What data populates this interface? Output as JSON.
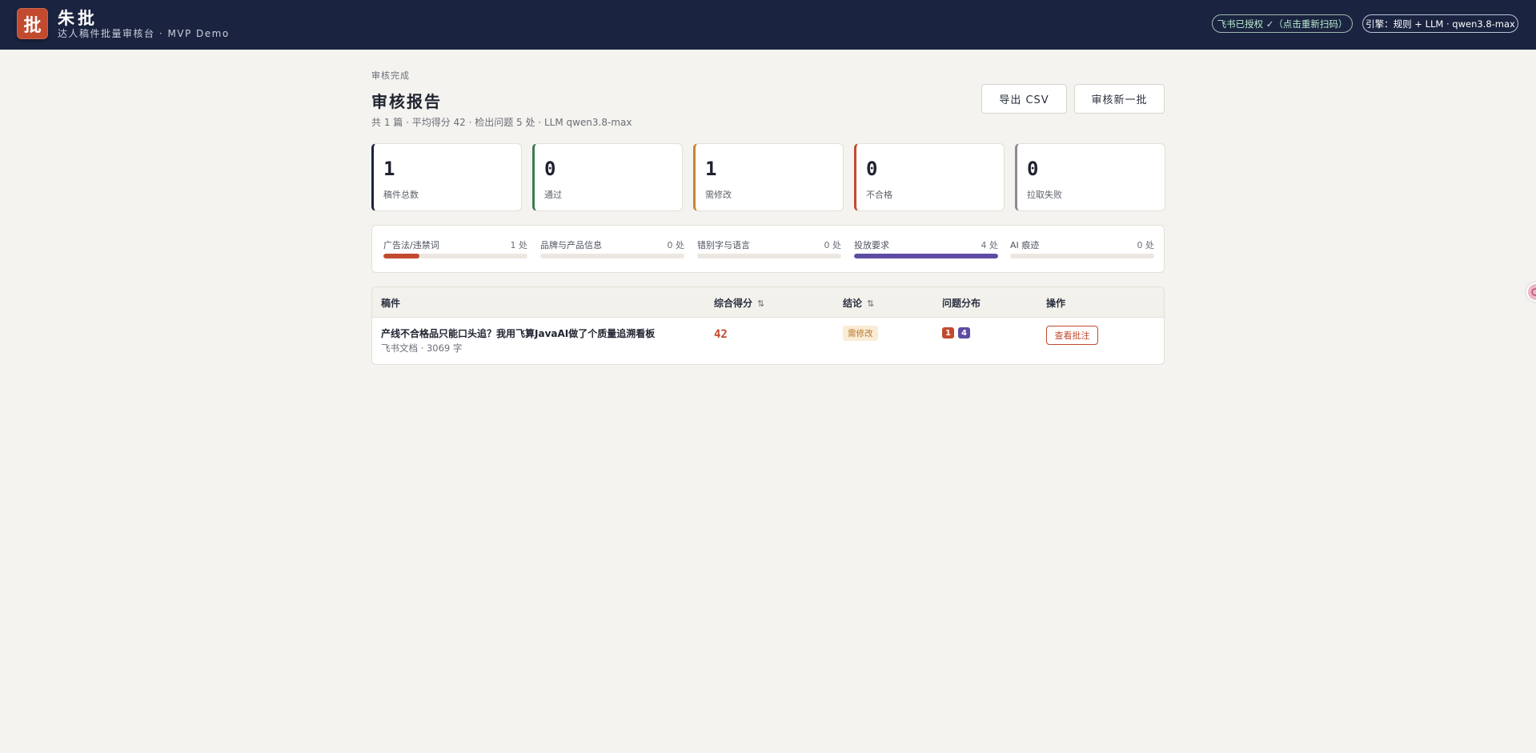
{
  "header": {
    "logo_char": "批",
    "brand_name": "朱批",
    "brand_subtitle": "达人稿件批量审核台 · MVP Demo",
    "auth_status": "飞书已授权 ✓（点击重新扫码）",
    "engine": "引擎：规则 + LLM · qwen3.8-max"
  },
  "report": {
    "eyebrow": "审核完成",
    "title": "审核报告",
    "summary": "共 1 篇 · 平均得分 42 · 检出问题 5 处 · LLM qwen3.8-max",
    "export_label": "导出 CSV",
    "new_batch_label": "审核新一批"
  },
  "stats": [
    {
      "value": "1",
      "label": "稿件总数",
      "color": "#1a2440"
    },
    {
      "value": "0",
      "label": "通过",
      "color": "#3e7a52"
    },
    {
      "value": "1",
      "label": "需修改",
      "color": "#c98430"
    },
    {
      "value": "0",
      "label": "不合格",
      "color": "#c24a2f"
    },
    {
      "value": "0",
      "label": "拉取失败",
      "color": "#8f8a96"
    }
  ],
  "categories": [
    {
      "name": "广告法/违禁词",
      "count": "1 处",
      "value": 1,
      "color": "#c24a2f"
    },
    {
      "name": "品牌与产品信息",
      "count": "0 处",
      "value": 0,
      "color": "#c24a2f"
    },
    {
      "name": "错别字与语言",
      "count": "0 处",
      "value": 0,
      "color": "#c24a2f"
    },
    {
      "name": "投放要求",
      "count": "4 处",
      "value": 4,
      "color": "#5e4ca3"
    },
    {
      "name": "AI 痕迹",
      "count": "0 处",
      "value": 0,
      "color": "#c24a2f"
    }
  ],
  "category_max": 4,
  "table": {
    "headers": {
      "doc": "稿件",
      "score": "综合得分",
      "verdict": "结论",
      "issues": "问题分布",
      "action": "操作"
    },
    "sort_icon": "⇅",
    "rows": [
      {
        "title": "产线不合格品只能口头追？我用飞算JavaAI做了个质量追溯看板",
        "meta": "飞书文档 · 3069 字",
        "score": "42",
        "verdict": "需修改",
        "issue_badges": [
          {
            "count": "1",
            "color": "#c24a2f"
          },
          {
            "count": "4",
            "color": "#5e4ca3"
          }
        ],
        "action_label": "查看批注"
      }
    ]
  }
}
